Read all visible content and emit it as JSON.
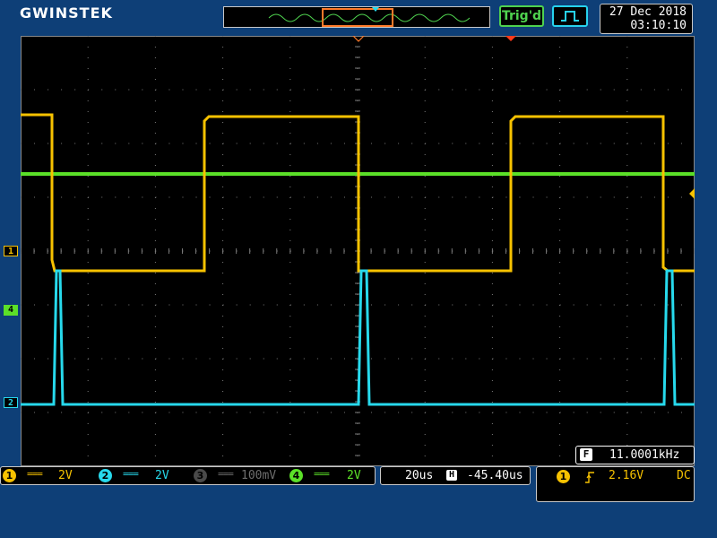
{
  "header": {
    "brand": "GWINSTEK",
    "trigger_status": "Trig'd",
    "date": "27 Dec 2018",
    "time": "03:10:10"
  },
  "colors": {
    "background": "#0e3f77",
    "ch1": "#f7c200",
    "ch2": "#27d9ec",
    "ch3": "#6e6e6e",
    "ch4": "#5be028",
    "grid": "#7a7a7a"
  },
  "channel_markers": [
    {
      "label": "1",
      "color": "#f7c200"
    },
    {
      "label": "4",
      "color": "#5be028"
    },
    {
      "label": "2",
      "color": "#27d9ec"
    }
  ],
  "frequency": {
    "icon": "F",
    "value": "11.0001kHz"
  },
  "channels": [
    {
      "num": "1",
      "coupling": "===",
      "scale": "2V",
      "active": true
    },
    {
      "num": "2",
      "coupling": "===",
      "scale": "2V",
      "active": true
    },
    {
      "num": "3",
      "coupling": "===",
      "scale": "100mV",
      "active": false
    },
    {
      "num": "4",
      "coupling": "===",
      "scale": "2V",
      "active": true
    }
  ],
  "timebase": {
    "scale": "20us",
    "position_icon": "H",
    "position": "-45.40us"
  },
  "trigger": {
    "source": "1",
    "slope_icon": "rising-edge-icon",
    "level": "2.16V",
    "coupling": "DC"
  }
}
